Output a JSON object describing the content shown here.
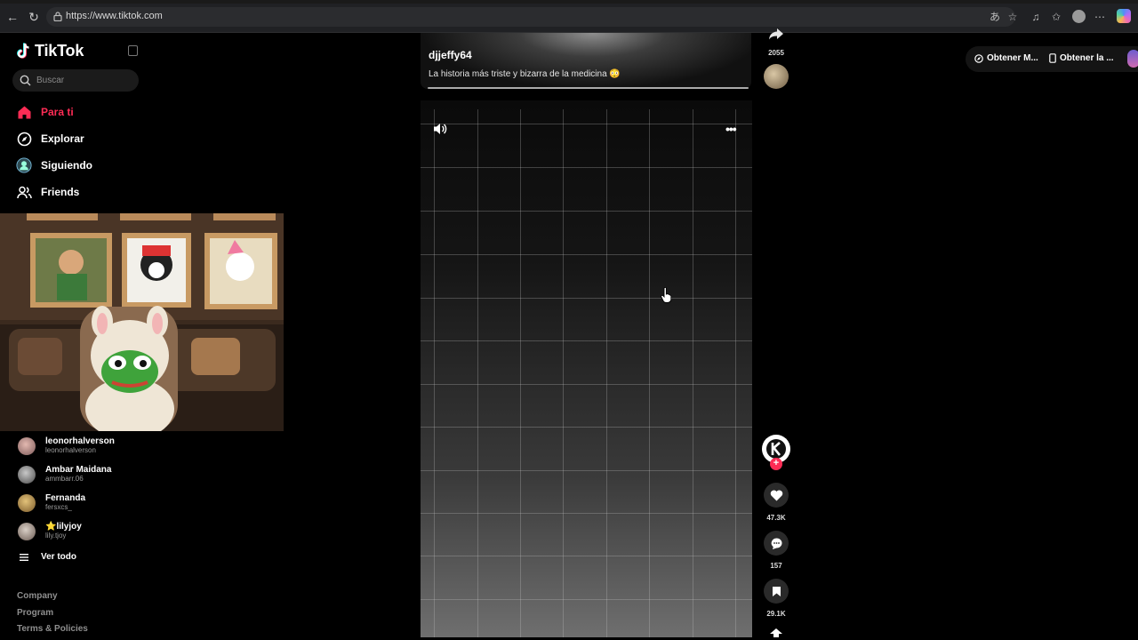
{
  "browser": {
    "url": "https://www.tiktok.com"
  },
  "sidebar": {
    "logo_text": "TikTok",
    "search_placeholder": "Buscar",
    "nav": [
      {
        "label": "Para ti",
        "icon": "home-icon",
        "active": true
      },
      {
        "label": "Explorar",
        "icon": "compass-icon",
        "active": false
      },
      {
        "label": "Siguiendo",
        "icon": "following-icon",
        "active": false
      },
      {
        "label": "Friends",
        "icon": "friends-icon",
        "active": false
      }
    ],
    "following": [
      {
        "name": "leonorhalverson",
        "handle": "leonorhalverson"
      },
      {
        "name": "Ambar Maidana",
        "handle": "ammbarr.06"
      },
      {
        "name": "Fernanda",
        "handle": "fersxcs_"
      },
      {
        "name": "⭐lilyjoy",
        "handle": "lily.tjoy"
      }
    ],
    "see_all": "Ver todo",
    "footer": [
      "Company",
      "Program",
      "Terms & Policies"
    ]
  },
  "video": {
    "author": "djjeffy64",
    "caption": "La historia más triste y bizarra de la medicina 😳"
  },
  "actions": {
    "prev_share_count": "2055",
    "likes": "47.3K",
    "comments": "157",
    "saves": "29.1K"
  },
  "get_app": {
    "item1": "Obtener M...",
    "item2": "Obtener la ..."
  },
  "colors": {
    "accent": "#fe2c55",
    "background": "#000000"
  }
}
